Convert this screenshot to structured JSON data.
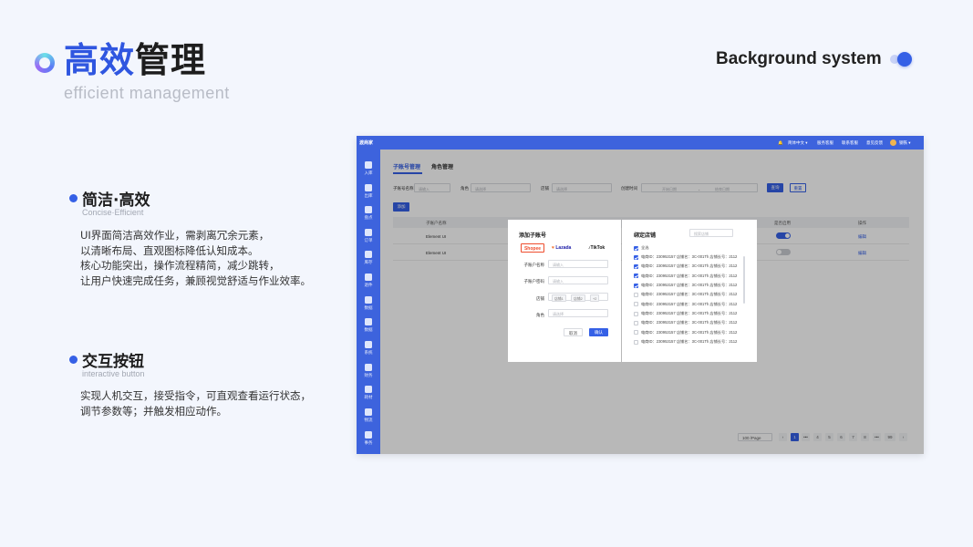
{
  "slide": {
    "title_blue": "高效",
    "title_dark": "管理",
    "subtitle": "efficient management",
    "right_label": "Background system"
  },
  "features": [
    {
      "heading": "简洁·高效",
      "en": "Concise·Efficient",
      "lines": [
        "UI界面简洁高效作业，需剥离冗余元素，",
        "以清晰布局、直观图标降低认知成本。",
        "核心功能突出，操作流程精简，减少跳转，",
        "让用户快速完成任务，兼顾视觉舒适与作业效率。"
      ]
    },
    {
      "heading": "交互按钮",
      "en": "interactive button",
      "lines": [
        "实现人机交互，接受指令，可直观查看运行状态，",
        "调节参数等；并触发相应动作。"
      ]
    }
  ],
  "app": {
    "brand": "渡商家",
    "topbar_items": [
      "简体中文 ▾",
      "服务客服",
      "联系客服",
      "意见反馈",
      "钢铁 ▾"
    ],
    "nav": [
      "入库",
      "出库",
      "盘点",
      "订单",
      "库存",
      "退件",
      "数据",
      "数据",
      "系统",
      "财务",
      "耗材",
      "物流",
      "事务"
    ],
    "tabs": [
      "子账号管理",
      "角色管理"
    ],
    "filters": {
      "name_label": "子账号名称",
      "name_ph": "请输入",
      "role_label": "角色",
      "role_ph": "请选择",
      "store_label": "店铺",
      "store_ph": "请选择",
      "time_label": "创建时间",
      "start_ph": "开始日期",
      "sep": "-",
      "end_ph": "结束日期",
      "search_btn": "查询",
      "reset_btn": "重置"
    },
    "add_btn": "添加",
    "table": {
      "headers": [
        "子账户名称",
        "是否启用",
        "操作"
      ],
      "rows": [
        {
          "name": "Element UI",
          "enabled": true,
          "action": "编辑"
        },
        {
          "name": "Element UI",
          "enabled": false,
          "action": "编辑"
        }
      ]
    },
    "pagination": {
      "page_size": "100 /Page",
      "pages": [
        "‹",
        "1",
        "•••",
        "4",
        "5",
        "6",
        "7",
        "8",
        "•••",
        "99",
        "›"
      ],
      "active": "1"
    },
    "modal": {
      "title": "添加子账号",
      "platforms": [
        "Shopee",
        "Lazada",
        "TikTok"
      ],
      "fields": [
        {
          "label": "子账户名称",
          "ph": "请输入"
        },
        {
          "label": "子账户密码",
          "ph": "请输入"
        }
      ],
      "store_label": "店铺",
      "store_chips": [
        "店铺1",
        "店铺2",
        "+2"
      ],
      "role_label": "角色",
      "role_ph": "请选择",
      "cancel": "取消",
      "ok": "确认"
    },
    "bind": {
      "title": "绑定店铺",
      "search_ph": "搜索店铺",
      "select_all": "全选",
      "rows": [
        {
          "text": "电商ID：230953157 店铺名：3C-001Th 店铺长号：2112",
          "checked": true
        },
        {
          "text": "电商ID：230953157 店铺名：3C-001Th 店铺长号：2112",
          "checked": true
        },
        {
          "text": "电商ID：230953157 店铺名：3C-001Th 店铺长号：2112",
          "checked": true
        },
        {
          "text": "电商ID：230953157 店铺名：3C-001Th 店铺长号：2112",
          "checked": true
        },
        {
          "text": "电商ID：230953157 店铺名：3C-001Th 店铺长号：2112",
          "checked": false
        },
        {
          "text": "电商ID：230953157 店铺名：3C-001Th 店铺长号：2112",
          "checked": false
        },
        {
          "text": "电商ID：230953157 店铺名：3C-001Th 店铺长号：2112",
          "checked": false
        },
        {
          "text": "电商ID：230953157 店铺名：3C-001Th 店铺长号：2112",
          "checked": false
        },
        {
          "text": "电商ID：230953157 店铺名：3C-001Th 店铺长号：2112",
          "checked": false
        },
        {
          "text": "电商ID：230953157 店铺名：3C-001Th 店铺长号：2112",
          "checked": false
        }
      ]
    }
  },
  "colors": {
    "accent": "#3560e6",
    "background": "#f3f6fd",
    "sidebar": "#3d63dd"
  }
}
